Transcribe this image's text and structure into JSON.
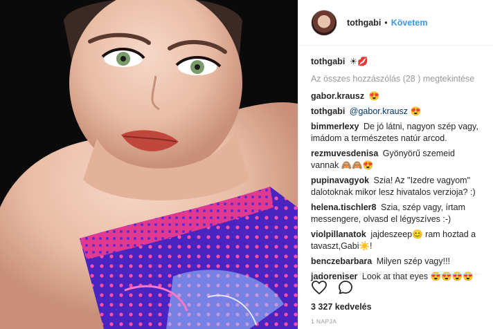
{
  "header": {
    "username": "tothgabi",
    "separator": "•",
    "follow_label": "Követem"
  },
  "caption": {
    "username": "tothgabi",
    "text": "☀💋"
  },
  "view_all": "Az összes hozzászólás (28 ) megtekintése",
  "comments": [
    {
      "user": "gabor.krausz",
      "mention": "",
      "text": "😍"
    },
    {
      "user": "tothgabi",
      "mention": "@gabor.krausz",
      "text": "😍"
    },
    {
      "user": "bimmerlexy",
      "mention": "",
      "text": "De jó látni, nagyon szép vagy, imádom a természetes natúr arcod."
    },
    {
      "user": "rezmuvesdenisa",
      "mention": "",
      "text": "Gyönyörű szemeid vannak 🙈🙈😍"
    },
    {
      "user": "pupinavagyok",
      "mention": "",
      "text": "Szia! Az \"Izedre vagyom\" dalotoknak mikor lesz hivatalos verzioja? :)"
    },
    {
      "user": "helena.tischler8",
      "mention": "",
      "text": "Szia, szép vagy, írtam messengere, olvasd el légyszíves :-)"
    },
    {
      "user": "violpillanatok",
      "mention": "",
      "text": "jajdeszeep😊 ram hoztad a tavaszt,Gabi☀️!"
    },
    {
      "user": "benczebarbara",
      "mention": "",
      "text": "Milyen szép vagy!!!"
    },
    {
      "user": "jadoreniser",
      "mention": "",
      "text": "Look at that eyes 😍😍😍😍"
    }
  ],
  "actions": {
    "like_icon": "heart-icon",
    "comment_icon": "comment-icon"
  },
  "likes": "3 327 kedvelés",
  "date": "1 NAPJA",
  "colors": {
    "follow": "#3897f0",
    "muted": "#999999",
    "text": "#262626"
  }
}
